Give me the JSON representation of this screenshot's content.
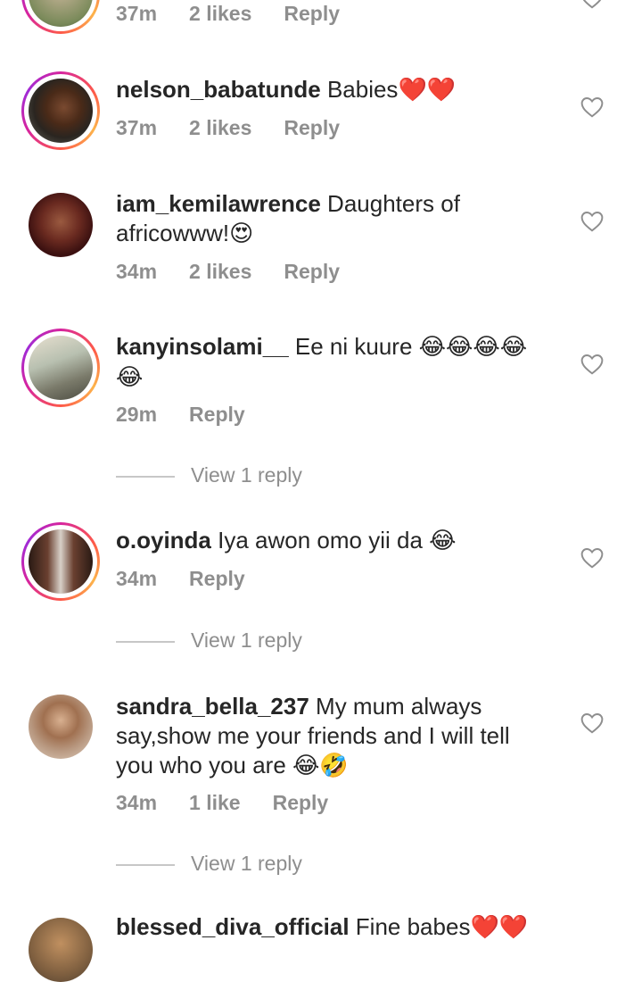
{
  "comments": [
    {
      "username": "",
      "text": "",
      "time": "37m",
      "likes": "2 likes",
      "reply": "Reply"
    },
    {
      "username": "nelson_babatunde",
      "text": "Babies",
      "emoji": "❤️❤️",
      "time": "37m",
      "likes": "2 likes",
      "reply": "Reply"
    },
    {
      "username": "iam_kemilawrence",
      "text": "Daughters of africowww!",
      "emoji": "😍",
      "time": "34m",
      "likes": "2 likes",
      "reply": "Reply"
    },
    {
      "username": "kanyinsolami__",
      "text": "Ee ni kuure",
      "emoji": "😂😂😂😂😂",
      "time": "29m",
      "likes": "",
      "reply": "Reply",
      "view_replies": "View 1 reply"
    },
    {
      "username": "o.oyinda",
      "text": "Iya awon omo yii da",
      "emoji": "😂",
      "time": "34m",
      "likes": "",
      "reply": "Reply",
      "view_replies": "View 1 reply"
    },
    {
      "username": "sandra_bella_237",
      "text": "My mum always say,show me your friends and I  will tell you who you are",
      "emoji": "😂🤣",
      "time": "34m",
      "likes": "1 like",
      "reply": "Reply",
      "view_replies": "View 1 reply"
    },
    {
      "username": "blessed_diva_official",
      "text": "Fine babes",
      "emoji": "❤️❤️"
    }
  ],
  "colors": {
    "text": "#262626",
    "meta": "#8e8e8e",
    "heart_red": "#e0101e",
    "story_ring": "#d6249f"
  },
  "icons": {
    "like": "heart-outline-icon"
  }
}
